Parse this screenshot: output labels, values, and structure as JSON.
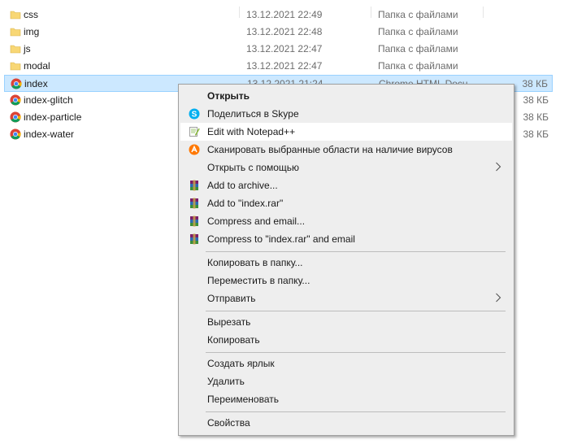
{
  "files": [
    {
      "name": "css",
      "date": "13.12.2021 22:49",
      "type": "Папка с файлами",
      "size": "",
      "icon": "folder-icon",
      "selected": false
    },
    {
      "name": "img",
      "date": "13.12.2021 22:48",
      "type": "Папка с файлами",
      "size": "",
      "icon": "folder-icon",
      "selected": false
    },
    {
      "name": "js",
      "date": "13.12.2021 22:47",
      "type": "Папка с файлами",
      "size": "",
      "icon": "folder-icon",
      "selected": false
    },
    {
      "name": "modal",
      "date": "13.12.2021 22:47",
      "type": "Папка с файлами",
      "size": "",
      "icon": "folder-icon",
      "selected": false
    },
    {
      "name": "index",
      "date": "13.12.2021 21:24",
      "type": "Chrome HTML Docu",
      "size": "38 КБ",
      "icon": "chrome-icon",
      "selected": true
    },
    {
      "name": "index-glitch",
      "date": "",
      "type": "",
      "size": "38 КБ",
      "icon": "chrome-icon",
      "selected": false
    },
    {
      "name": "index-particle",
      "date": "",
      "type": "",
      "size": "38 КБ",
      "icon": "chrome-icon",
      "selected": false
    },
    {
      "name": "index-water",
      "date": "",
      "type": "",
      "size": "38 КБ",
      "icon": "chrome-icon",
      "selected": false
    }
  ],
  "context_menu": {
    "items": [
      {
        "label": "Открыть",
        "bold": true,
        "icon": "",
        "submenu": false,
        "highlighted": false
      },
      {
        "label": "Поделиться в Skype",
        "bold": false,
        "icon": "skype-icon",
        "submenu": false,
        "highlighted": false
      },
      {
        "label": "Edit with Notepad++",
        "bold": false,
        "icon": "notepad-plus-plus-icon",
        "submenu": false,
        "highlighted": true
      },
      {
        "label": "Сканировать выбранные области на наличие вирусов",
        "bold": false,
        "icon": "avast-icon",
        "submenu": false,
        "highlighted": false
      },
      {
        "label": "Открыть с помощью",
        "bold": false,
        "icon": "",
        "submenu": true,
        "highlighted": false
      },
      {
        "label": "Add to archive...",
        "bold": false,
        "icon": "winrar-icon",
        "submenu": false,
        "highlighted": false
      },
      {
        "label": "Add to \"index.rar\"",
        "bold": false,
        "icon": "winrar-icon",
        "submenu": false,
        "highlighted": false
      },
      {
        "label": "Compress and email...",
        "bold": false,
        "icon": "winrar-icon",
        "submenu": false,
        "highlighted": false
      },
      {
        "label": "Compress to \"index.rar\" and email",
        "bold": false,
        "icon": "winrar-icon",
        "submenu": false,
        "highlighted": false
      },
      {
        "separator": true
      },
      {
        "label": "Копировать в папку...",
        "bold": false,
        "icon": "",
        "submenu": false,
        "highlighted": false
      },
      {
        "label": "Переместить в папку...",
        "bold": false,
        "icon": "",
        "submenu": false,
        "highlighted": false
      },
      {
        "label": "Отправить",
        "bold": false,
        "icon": "",
        "submenu": true,
        "highlighted": false
      },
      {
        "separator": true
      },
      {
        "label": "Вырезать",
        "bold": false,
        "icon": "",
        "submenu": false,
        "highlighted": false
      },
      {
        "label": "Копировать",
        "bold": false,
        "icon": "",
        "submenu": false,
        "highlighted": false
      },
      {
        "separator": true
      },
      {
        "label": "Создать ярлык",
        "bold": false,
        "icon": "",
        "submenu": false,
        "highlighted": false
      },
      {
        "label": "Удалить",
        "bold": false,
        "icon": "",
        "submenu": false,
        "highlighted": false
      },
      {
        "label": "Переименовать",
        "bold": false,
        "icon": "",
        "submenu": false,
        "highlighted": false
      },
      {
        "separator": true
      },
      {
        "label": "Свойства",
        "bold": false,
        "icon": "",
        "submenu": false,
        "highlighted": false
      }
    ]
  },
  "colors": {
    "selection_bg": "#cce8ff",
    "selection_border": "#99d1ff",
    "menu_bg": "#eeeeee",
    "menu_highlight": "#ffffff",
    "folder": "#f8d775"
  }
}
